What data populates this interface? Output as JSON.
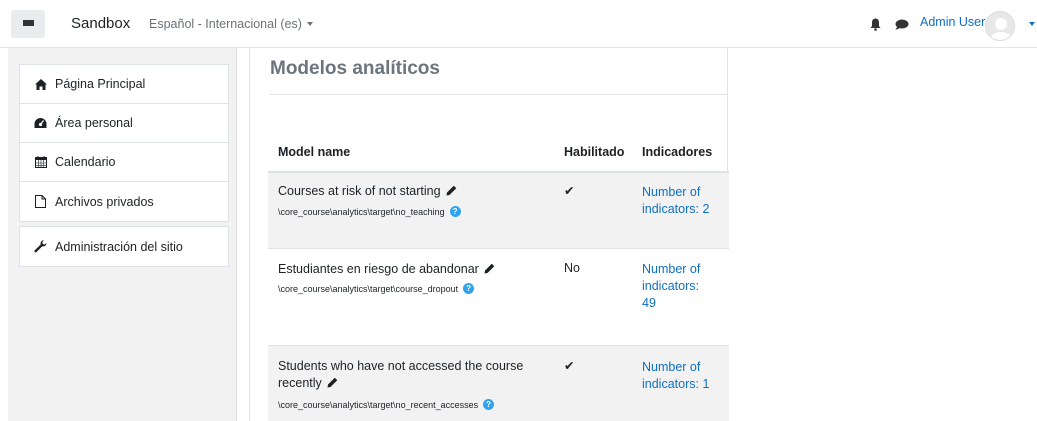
{
  "navbar": {
    "brand": "Sandbox",
    "language": "Español - Internacional (es)",
    "user_name": "Admin User"
  },
  "drawer": {
    "items": [
      {
        "label": "Página Principal",
        "icon": "home-icon"
      },
      {
        "label": "Área personal",
        "icon": "dashboard-icon"
      },
      {
        "label": "Calendario",
        "icon": "calendar-icon"
      },
      {
        "label": "Archivos privados",
        "icon": "file-icon"
      }
    ],
    "admin": {
      "label": "Administración del sitio",
      "icon": "wrench-icon"
    }
  },
  "page": {
    "title": "Modelos analíticos"
  },
  "table": {
    "headers": {
      "model_name": "Model name",
      "enabled": "Habilitado",
      "indicators": "Indicadores"
    },
    "rows": [
      {
        "name_line1": "Courses at risk of not starting",
        "name_line2": "",
        "target": "\\core_course\\analytics\\target\\no_teaching",
        "enabled": "✔",
        "indicators_line1": "Number of",
        "indicators_line2": "indicators: 2",
        "indicators_line3": ""
      },
      {
        "name_line1": "Estudiantes en riesgo de abandonar",
        "name_line2": "",
        "target": "\\core_course\\analytics\\target\\course_dropout",
        "enabled": "No",
        "indicators_line1": "Number of",
        "indicators_line2": "indicators:",
        "indicators_line3": "49"
      },
      {
        "name_line1": "Students who have not accessed the course",
        "name_line2": "recently",
        "target": "\\core_course\\analytics\\target\\no_recent_accesses",
        "enabled": "✔",
        "indicators_line1": "Number of",
        "indicators_line2": "indicators: 1",
        "indicators_line3": ""
      }
    ]
  },
  "colors": {
    "link": "#0f6fc5",
    "help": "#2ea3f2",
    "stripe": "#f2f2f2"
  }
}
